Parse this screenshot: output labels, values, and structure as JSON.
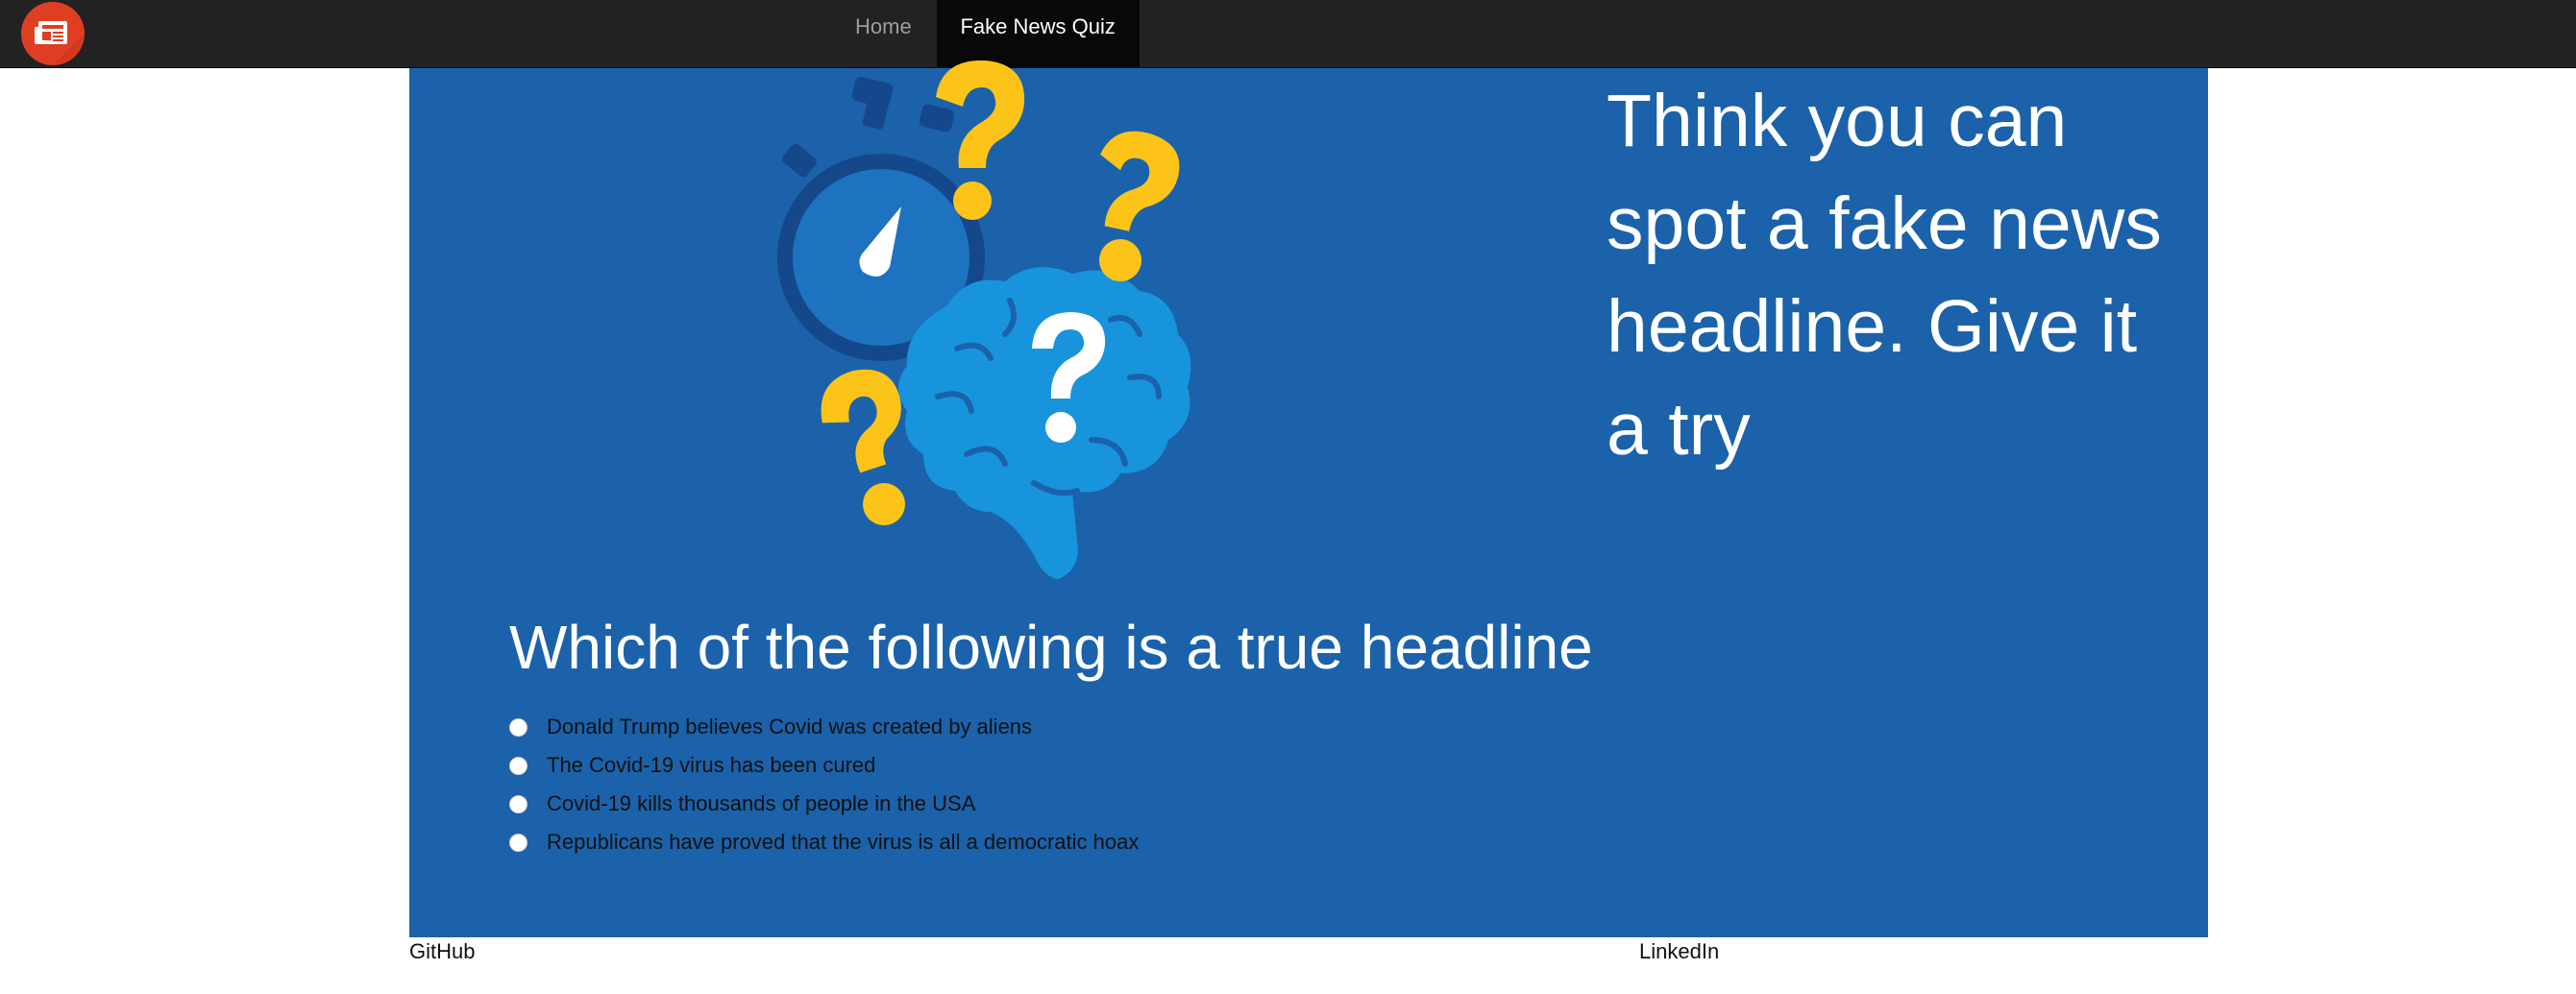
{
  "nav": {
    "logo_icon": "newspaper-icon",
    "items": [
      {
        "label": "Home",
        "active": false
      },
      {
        "label": "Fake News Quiz",
        "active": true
      }
    ]
  },
  "hero": {
    "illustration": "stopwatch-brain-question-marks",
    "tagline": "Think you can spot a fake news headline. Give it a try",
    "background_color": "#1b62aa"
  },
  "quiz": {
    "question": "Which of the following is a true headline",
    "options": [
      "Donald Trump believes Covid was created by aliens",
      "The Covid-19 virus has been cured",
      "Covid-19 kills thousands of people in the USA",
      "Republicans have proved that the virus is all a democratic hoax"
    ]
  },
  "footer": {
    "github": "GitHub",
    "linkedin": "LinkedIn"
  },
  "colors": {
    "navbar": "#222222",
    "accent_yellow": "#fcc419",
    "brain_blue": "#1794dc",
    "logo_red": "#e03e22"
  }
}
